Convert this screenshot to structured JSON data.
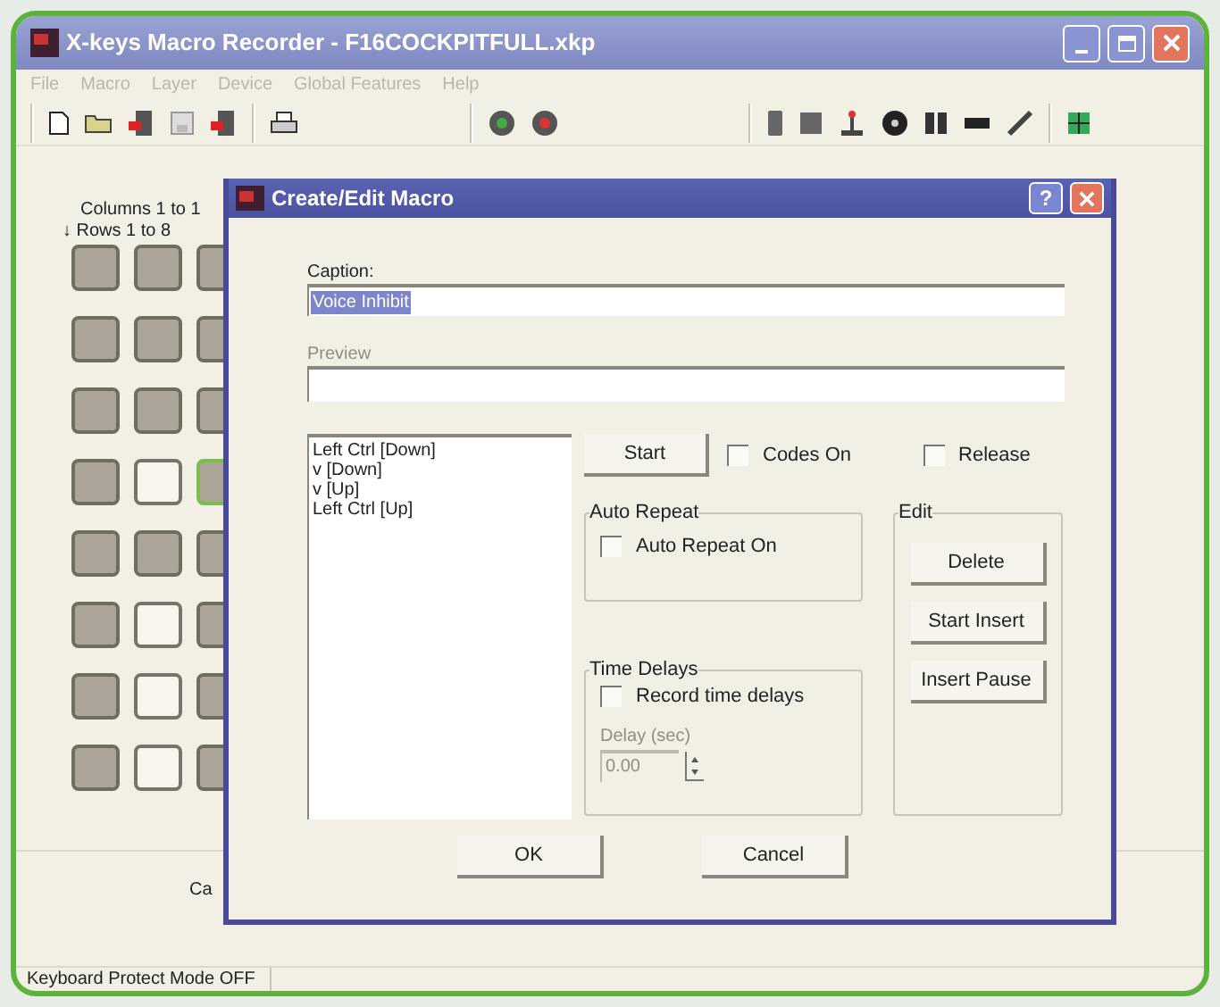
{
  "window": {
    "title": "X-keys Macro Recorder - F16COCKPITFULL.xkp"
  },
  "menu": [
    "File",
    "Macro",
    "Layer",
    "Device",
    "Global Features",
    "Help"
  ],
  "layout": {
    "columns_label": "Columns 1 to 1",
    "rows_label": "↓ Rows 1 to 8",
    "rows": [
      [
        {
          "kind": "gray"
        },
        {
          "kind": "gray"
        },
        {
          "kind": "gray"
        }
      ],
      [
        {
          "kind": "gray"
        },
        {
          "kind": "gray"
        },
        {
          "kind": "gray"
        }
      ],
      [
        {
          "kind": "gray"
        },
        {
          "kind": "gray"
        },
        {
          "kind": "gray"
        }
      ],
      [
        {
          "kind": "gray"
        },
        {
          "kind": "white"
        },
        {
          "kind": "green"
        }
      ],
      [
        {
          "kind": "gray"
        },
        {
          "kind": "gray"
        },
        {
          "kind": "gray"
        }
      ],
      [
        {
          "kind": "gray"
        },
        {
          "kind": "white"
        },
        {
          "kind": "gray"
        }
      ],
      [
        {
          "kind": "gray"
        },
        {
          "kind": "white"
        },
        {
          "kind": "gray"
        }
      ],
      [
        {
          "kind": "gray"
        },
        {
          "kind": "white"
        },
        {
          "kind": "gray"
        }
      ]
    ]
  },
  "bottom_panel": {
    "label": "Ca"
  },
  "status_bar": "Keyboard Protect Mode OFF",
  "dialog": {
    "title": "Create/Edit Macro",
    "help_button": "?",
    "caption": {
      "label": "Caption:",
      "value": "Voice Inhibit",
      "selected": true
    },
    "preview": {
      "label": "Preview",
      "disabled": true
    },
    "sequence": [
      "Left Ctrl [Down]",
      "v [Down]",
      "v [Up]",
      "Left Ctrl [Up]"
    ],
    "start_button": "Start",
    "codes_on": {
      "label": "Codes On",
      "checked": false
    },
    "release": {
      "label": "Release",
      "checked": false
    },
    "auto_repeat": {
      "title": "Auto Repeat",
      "checkbox": {
        "label": "Auto Repeat On",
        "checked": false
      }
    },
    "time_delays": {
      "title": "Time Delays",
      "checkbox": {
        "label": "Record time delays",
        "checked": false
      },
      "delay_label": "Delay (sec)",
      "delay_value": "0.00",
      "disabled": true
    },
    "edit": {
      "title": "Edit",
      "buttons": [
        "Delete",
        "Start Insert",
        "Insert Pause"
      ]
    },
    "ok": "OK",
    "cancel": "Cancel"
  }
}
